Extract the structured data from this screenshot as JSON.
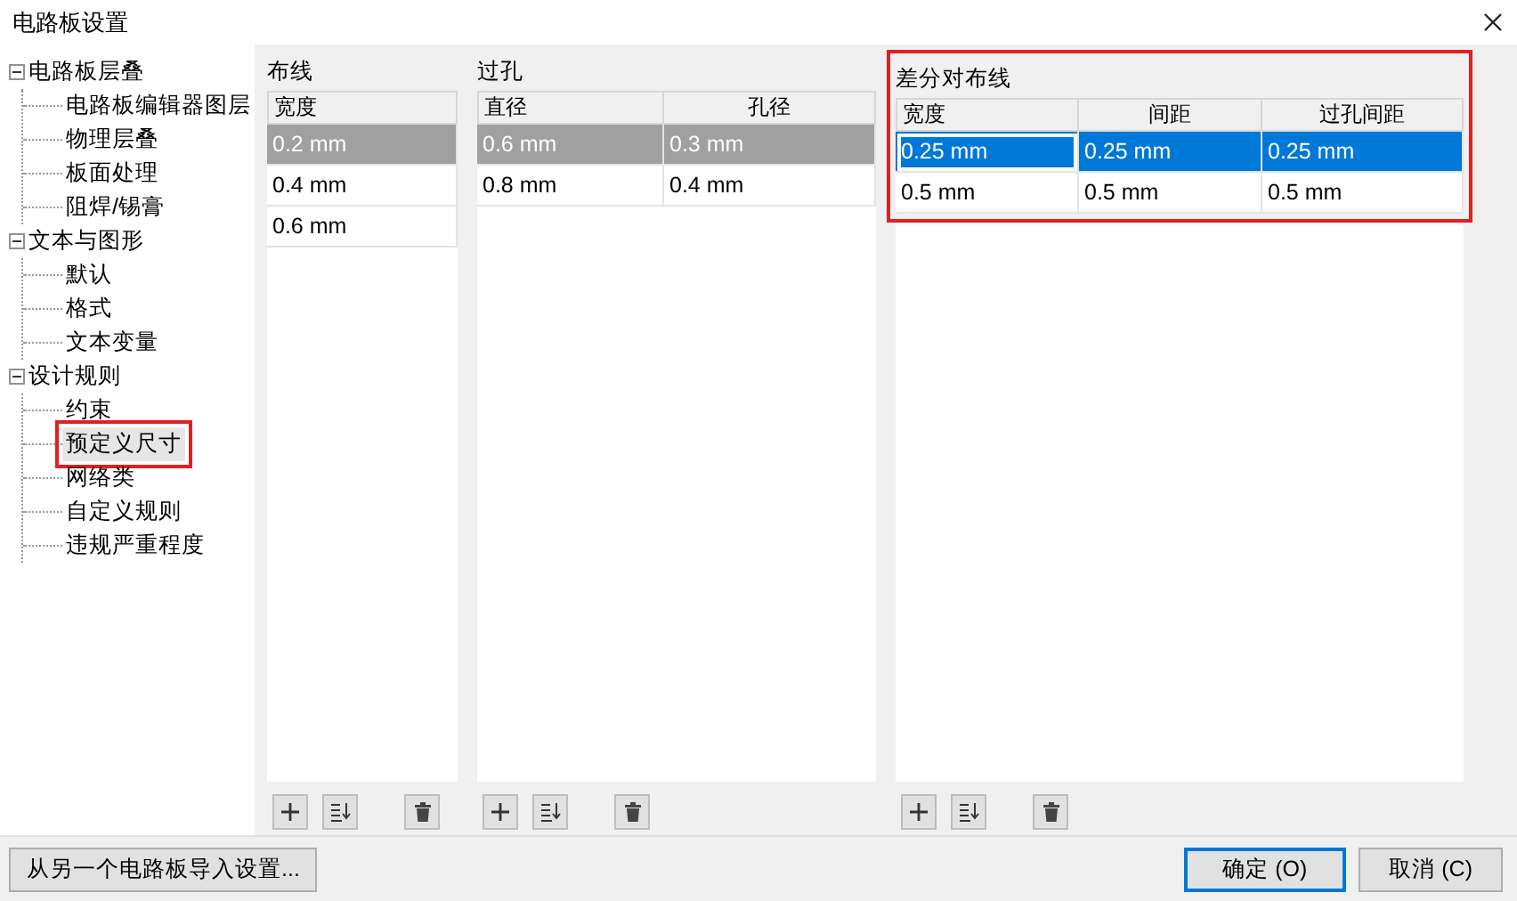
{
  "window": {
    "title": "电路板设置"
  },
  "tree": [
    {
      "label": "电路板层叠",
      "expanded": true,
      "children": [
        {
          "label": "电路板编辑器图层",
          "selected": false,
          "highlighted": false
        },
        {
          "label": "物理层叠",
          "selected": false,
          "highlighted": false
        },
        {
          "label": "板面处理",
          "selected": false,
          "highlighted": false
        },
        {
          "label": "阻焊/锡膏",
          "selected": false,
          "highlighted": false
        }
      ]
    },
    {
      "label": "文本与图形",
      "expanded": true,
      "children": [
        {
          "label": "默认",
          "selected": false,
          "highlighted": false
        },
        {
          "label": "格式",
          "selected": false,
          "highlighted": false
        },
        {
          "label": "文本变量",
          "selected": false,
          "highlighted": false
        }
      ]
    },
    {
      "label": "设计规则",
      "expanded": true,
      "children": [
        {
          "label": "约束",
          "selected": false,
          "highlighted": false
        },
        {
          "label": "预定义尺寸",
          "selected": true,
          "highlighted": true
        },
        {
          "label": "网络类",
          "selected": false,
          "highlighted": false
        },
        {
          "label": "自定义规则",
          "selected": false,
          "highlighted": false
        },
        {
          "label": "违规严重程度",
          "selected": false,
          "highlighted": false
        }
      ]
    }
  ],
  "sections": [
    {
      "title": "布线",
      "highlighted": false,
      "focused": false,
      "columns": [
        "宽度"
      ],
      "rows": [
        {
          "selected": true,
          "cells": [
            "0.2 mm"
          ]
        },
        {
          "selected": false,
          "cells": [
            "0.4 mm"
          ]
        },
        {
          "selected": false,
          "cells": [
            "0.6 mm"
          ]
        }
      ]
    },
    {
      "title": "过孔",
      "highlighted": false,
      "focused": false,
      "columns": [
        "直径",
        "孔径"
      ],
      "rows": [
        {
          "selected": true,
          "cells": [
            "0.6 mm",
            "0.3 mm"
          ]
        },
        {
          "selected": false,
          "cells": [
            "0.8 mm",
            "0.4 mm"
          ]
        }
      ]
    },
    {
      "title": "差分对布线",
      "highlighted": true,
      "focused": true,
      "columns": [
        "宽度",
        "间距",
        "过孔间距"
      ],
      "rows": [
        {
          "selected": true,
          "cells": [
            "0.25 mm",
            "0.25 mm",
            "0.25 mm"
          ]
        },
        {
          "selected": false,
          "cells": [
            "0.5 mm",
            "0.5 mm",
            "0.5 mm"
          ]
        }
      ]
    }
  ],
  "footer": {
    "import_button": "从另一个电路板导入设置...",
    "ok_button": "确定 (O)",
    "cancel_button": "取消 (C)"
  }
}
